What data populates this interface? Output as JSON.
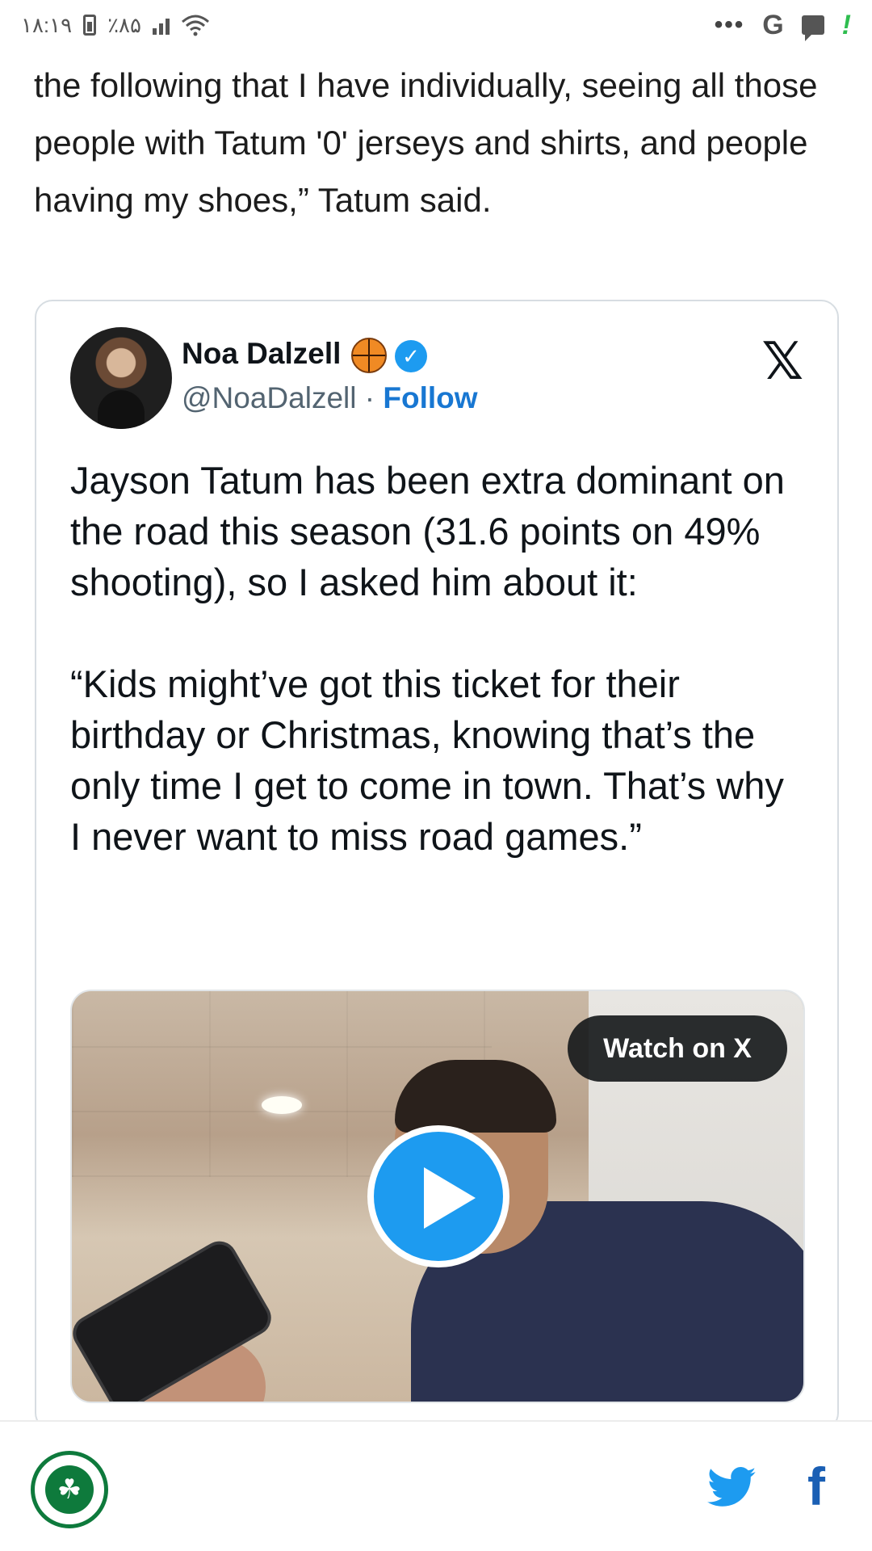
{
  "status_bar": {
    "time": "۱۸:۱۹",
    "battery": "٪۸۵"
  },
  "article": {
    "paragraph": "the following that I have individually, seeing all those people with Tatum '0' jerseys and shirts, and people having my shoes,” Tatum said."
  },
  "tweet": {
    "author_name": "Noa Dalzell",
    "handle": "@NoaDalzell",
    "separator": " · ",
    "follow_label": "Follow",
    "x_logo": "𝕏",
    "text_p1": "Jayson Tatum has been extra dominant on the road this season (31.6 points on 49% shooting), so I asked him about it:",
    "text_p2": "“Kids might’ve got this ticket for their birthday or Christmas, knowing that’s the only time I get to come in town. That’s why I never want to miss road games.”",
    "video": {
      "watch_label": "Watch on X"
    }
  },
  "bottom_bar": {
    "facebook_glyph": "f"
  },
  "colors": {
    "twitter_blue": "#1d9bf0",
    "follow_blue": "#1877d2",
    "accent_green": "#0e7a3c"
  }
}
